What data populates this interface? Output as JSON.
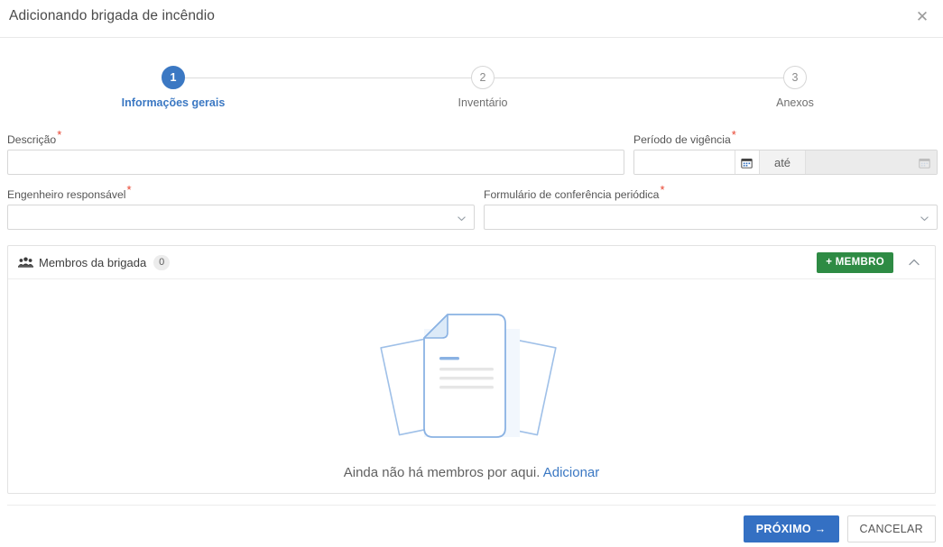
{
  "dialog": {
    "title": "Adicionando brigada de incêndio",
    "close_label": "✕"
  },
  "stepper": {
    "steps": [
      {
        "number": "1",
        "label": "Informações gerais",
        "state": "active"
      },
      {
        "number": "2",
        "label": "Inventário",
        "state": "inactive"
      },
      {
        "number": "3",
        "label": "Anexos",
        "state": "inactive"
      }
    ],
    "active_color": "#3b78c3",
    "inactive_color": "#8b8b8b"
  },
  "form": {
    "descricao": {
      "label": "Descrição",
      "required_marker": "*",
      "value": "",
      "placeholder": ""
    },
    "periodo_vigencia": {
      "label": "Período de vigência",
      "required_marker": "*",
      "start_value": "",
      "start_placeholder": "",
      "separator_label": "até",
      "end_value": "",
      "end_placeholder": "",
      "start_icon": "calendar-icon",
      "end_icon": "calendar-icon"
    },
    "engenheiro": {
      "label": "Engenheiro responsável",
      "required_marker": "*",
      "value": "",
      "caret_icon": "chevron-down-icon"
    },
    "formulario_conferencia": {
      "label": "Formulário de conferência periódica",
      "required_marker": "*",
      "value": "",
      "caret_icon": "chevron-down-icon"
    }
  },
  "members_panel": {
    "icon": "group-people-icon",
    "title": "Membros da brigada",
    "count": "0",
    "add_button_label": "+ MEMBRO",
    "add_button_color": "#2e8b44",
    "collapse_icon": "chevron-up-icon",
    "empty_state": {
      "illustration": "empty-documents-illustration",
      "message": "Ainda não há membros por aqui.",
      "link_label": "Adicionar",
      "link_color": "#3b78c3"
    }
  },
  "footer": {
    "next_label": "PRÓXIMO →",
    "next_color": "#3470c3",
    "cancel_label": "CANCELAR"
  }
}
